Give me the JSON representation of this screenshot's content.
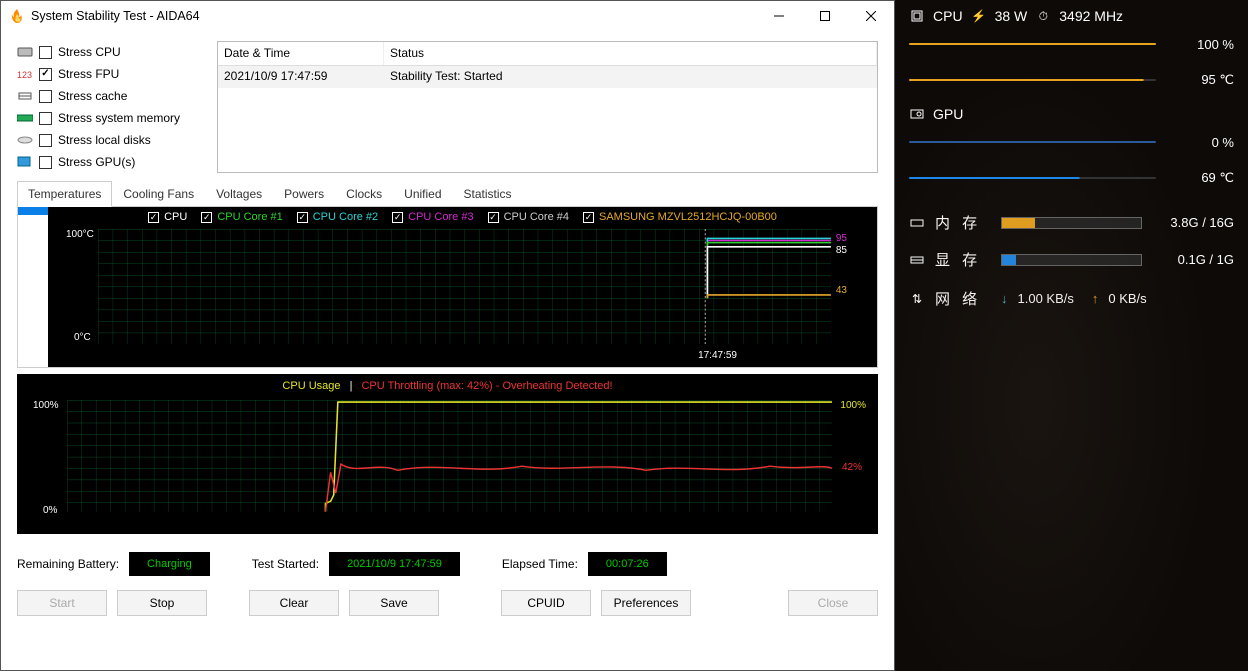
{
  "window": {
    "title": "System Stability Test - AIDA64"
  },
  "stress": {
    "items": [
      {
        "label": "Stress CPU",
        "checked": false
      },
      {
        "label": "Stress FPU",
        "checked": true
      },
      {
        "label": "Stress cache",
        "checked": false
      },
      {
        "label": "Stress system memory",
        "checked": false
      },
      {
        "label": "Stress local disks",
        "checked": false
      },
      {
        "label": "Stress GPU(s)",
        "checked": false
      }
    ]
  },
  "log": {
    "header_date": "Date & Time",
    "header_status": "Status",
    "row_date": "2021/10/9 17:47:59",
    "row_status": "Stability Test: Started"
  },
  "tabs": [
    "Temperatures",
    "Cooling Fans",
    "Voltages",
    "Powers",
    "Clocks",
    "Unified",
    "Statistics"
  ],
  "temp_chart": {
    "legend": [
      {
        "label": "CPU",
        "color": "#ffffff"
      },
      {
        "label": "CPU Core #1",
        "color": "#2bd32b"
      },
      {
        "label": "CPU Core #2",
        "color": "#2ad3d3"
      },
      {
        "label": "CPU Core #3",
        "color": "#d32ad3"
      },
      {
        "label": "CPU Core #4",
        "color": "#cccccc"
      },
      {
        "label": "SAMSUNG MZVL2512HCJQ-00B00",
        "color": "#e5a928"
      }
    ],
    "y_max": "100°C",
    "y_min": "0°C",
    "marks_right": [
      "95",
      "85",
      "43"
    ],
    "mark_colors": [
      "#d32ad3",
      "#ffffff",
      "#e5a928"
    ],
    "time_label": "17:47:59"
  },
  "usage_chart": {
    "left_label": "CPU Usage",
    "right_label": "CPU Throttling (max: 42%) - Overheating Detected!",
    "separator": "|",
    "y_max": "100%",
    "y_min": "0%",
    "r_max": "100%",
    "r_mid": "42%"
  },
  "status": {
    "battery_lbl": "Remaining Battery:",
    "battery_val": "Charging",
    "started_lbl": "Test Started:",
    "started_val": "2021/10/9 17:47:59",
    "elapsed_lbl": "Elapsed Time:",
    "elapsed_val": "00:07:26"
  },
  "buttons": {
    "start": "Start",
    "stop": "Stop",
    "clear": "Clear",
    "save": "Save",
    "cpuid": "CPUID",
    "prefs": "Preferences",
    "close": "Close"
  },
  "overlay": {
    "cpu": {
      "label": "CPU",
      "watt": "38 W",
      "mhz": "3492 MHz",
      "load": "100 %",
      "temp": "95 ℃"
    },
    "gpu": {
      "label": "GPU",
      "load": "0 %",
      "temp": "69 ℃"
    },
    "ram": {
      "label": "内 存",
      "used": "3.8G / 16G",
      "fill_pct": 24,
      "color": "#e8a31e"
    },
    "vram": {
      "label": "显 存",
      "used": "0.1G / 1G",
      "fill_pct": 10,
      "color": "#1e88e8"
    },
    "net": {
      "label": "网 络",
      "down": "1.00 KB/s",
      "up": "0 KB/s"
    }
  },
  "chart_data": {
    "type": "line-multi",
    "temperature_chart": {
      "ylim": [
        0,
        100
      ],
      "timestamp_marker": "17:47:59",
      "series_current_values": {
        "CPU": 85,
        "CPU Core #1": 95,
        "CPU Core #2": 95,
        "CPU Core #3": 95,
        "CPU Core #4": 95,
        "SAMSUNG MZVL2512HCJQ-00B00": 43
      }
    },
    "usage_chart": {
      "ylim": [
        0,
        100
      ],
      "cpu_usage_current": 100,
      "cpu_throttling_current": 42
    }
  }
}
